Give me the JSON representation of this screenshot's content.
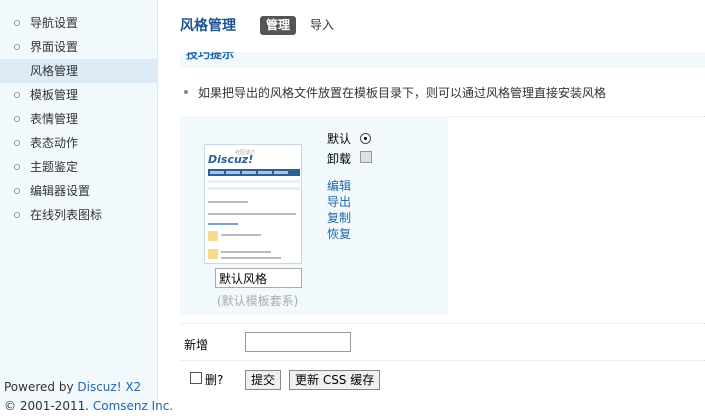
{
  "sidebar": {
    "items": [
      {
        "label": "导航设置"
      },
      {
        "label": "界面设置"
      },
      {
        "label": "风格管理",
        "active": true
      },
      {
        "label": "模板管理"
      },
      {
        "label": "表情管理"
      },
      {
        "label": "表态动作"
      },
      {
        "label": "主题鉴定"
      },
      {
        "label": "编辑器设置"
      },
      {
        "label": "在线列表图标"
      }
    ],
    "footer": {
      "powered_prefix": "Powered by ",
      "powered_link": "Discuz! X2",
      "copyright_prefix": "© 2001-2011. ",
      "copyright_link": "Comsenz Inc."
    }
  },
  "header": {
    "title": "风格管理",
    "tabs": [
      {
        "label": "管理",
        "active": true
      },
      {
        "label": "导入"
      }
    ]
  },
  "tips": {
    "title": "技巧提示",
    "text": "如果把导出的风格文件放置在模板目录下，则可以通过风格管理直接安装风格"
  },
  "style_item": {
    "thumbnail": {
      "logo": "Discuz!",
      "logo_sub": "社区动力"
    },
    "name_value": "默认风格",
    "template_dir": "(默认模板套系)",
    "default_label": "默认",
    "default_checked": true,
    "uninstall_label": "卸载",
    "uninstall_disabled": true,
    "actions": [
      "编辑",
      "导出",
      "复制",
      "恢复"
    ]
  },
  "add_row": {
    "label": "新增",
    "value": ""
  },
  "footer_row": {
    "delete_label": "删?",
    "submit_label": "提交",
    "update_cache_label": "更新 CSS 缓存"
  },
  "colors": {
    "sidebar_bg": "#f2f9fd",
    "active_bg": "#dcebf6",
    "title_blue": "#1e5494",
    "link_blue": "#2366a8"
  }
}
